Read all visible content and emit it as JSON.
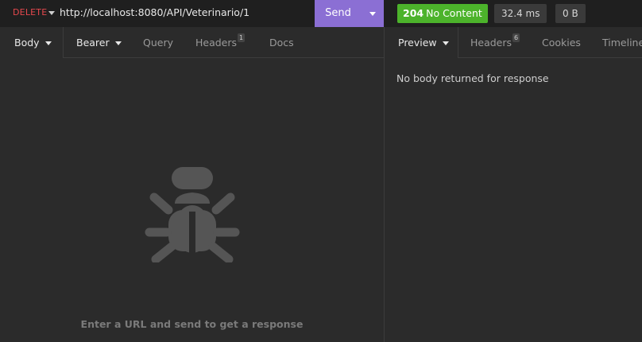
{
  "request": {
    "method": "DELETE",
    "url": "http://localhost:8080/API/Veterinario/1",
    "send_label": "Send"
  },
  "response": {
    "status_code": "204",
    "status_text": "No Content",
    "time": "32.4 ms",
    "size": "0 B"
  },
  "request_tabs": {
    "body": "Body",
    "auth": "Bearer",
    "query": "Query",
    "headers": "Headers",
    "headers_count": "1",
    "docs": "Docs"
  },
  "response_tabs": {
    "preview": "Preview",
    "headers": "Headers",
    "headers_count": "6",
    "cookies": "Cookies",
    "timeline": "Timeline"
  },
  "request_empty_message": "Enter a URL and send to get a response",
  "response_empty_message": "No body returned for response",
  "colors": {
    "method_delete": "#e5484d",
    "send_button": "#8b6fd4",
    "status_success": "#4cb32b",
    "background": "#2b2b2b",
    "topbar": "#1f1f1f"
  },
  "icons": {
    "empty_state": "bug-icon"
  }
}
